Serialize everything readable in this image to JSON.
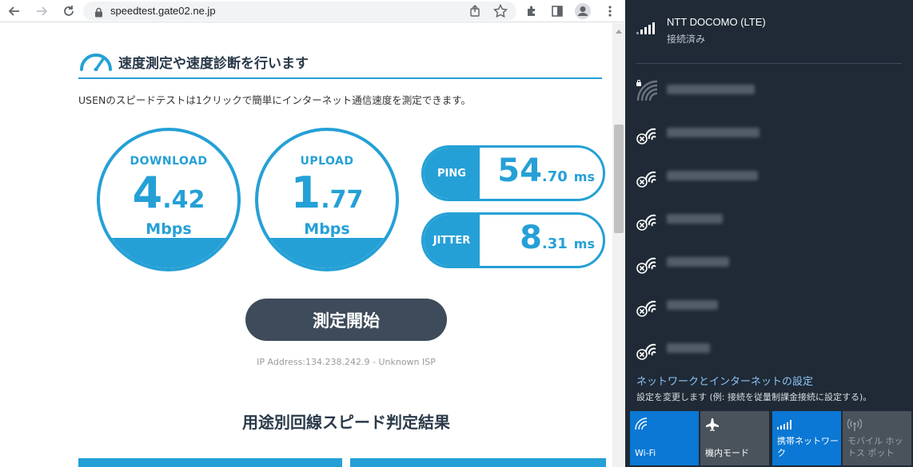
{
  "browser": {
    "url": "speedtest.gate02.ne.jp",
    "icons": [
      "back-icon",
      "forward-icon",
      "reload-icon",
      "lock-icon",
      "share-icon",
      "bookmark-star-icon",
      "extensions-icon",
      "side-panel-icon",
      "profile-icon",
      "menu-icon"
    ]
  },
  "page": {
    "heading": "速度測定や速度診断を行います",
    "description": "USENのスピードテストは1クリックで簡単にインターネット通信速度を測定できます。",
    "download": {
      "label": "DOWNLOAD",
      "int": "4",
      "frac": ".42",
      "unit": "Mbps"
    },
    "upload": {
      "label": "UPLOAD",
      "int": "1",
      "frac": ".77",
      "unit": "Mbps"
    },
    "ping": {
      "label": "PING",
      "int": "54",
      "frac": ".70",
      "unit": "ms"
    },
    "jitter": {
      "label": "JITTER",
      "int": "8",
      "frac": ".31",
      "unit": "ms"
    },
    "start_button": "測定開始",
    "ip_text": "IP Address:134.238.242.9 - Unknown ISP",
    "section_title": "用途別回線スピード判定結果"
  },
  "flyout": {
    "connected": {
      "name": "NTT DOCOMO (LTE)",
      "state": "接続済み"
    },
    "settings_link": "ネットワークとインターネットの設定",
    "settings_desc": "設定を変更します (例: 接続を従量制課金接続に設定する)。",
    "quick_actions": [
      {
        "label": "Wi-Fi"
      },
      {
        "label": "機内モード"
      },
      {
        "label": "携帯ネットワーク"
      },
      {
        "label": "モバイル ホットス ポット"
      }
    ],
    "colors": {
      "background": "#1f2a36",
      "accent": "#0a78d4",
      "tile": "#4a525c",
      "link": "#8fc4f5"
    }
  },
  "colors": {
    "accent": "#25a0d6",
    "button": "#3e4b5a",
    "heading": "#2b3a4a"
  }
}
